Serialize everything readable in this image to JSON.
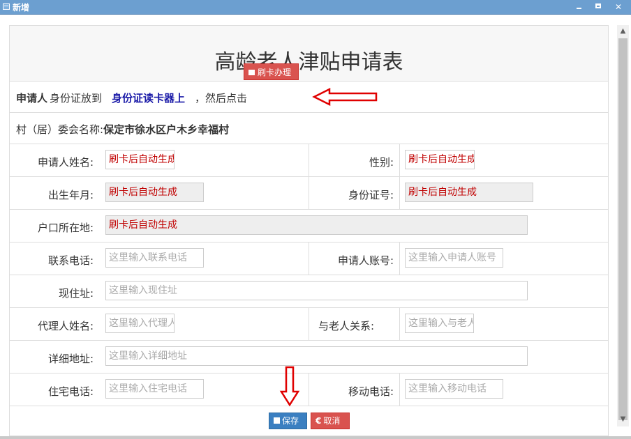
{
  "window": {
    "title": "新增"
  },
  "form": {
    "title": "高龄老人津贴申请表",
    "instruction": {
      "part1_bold": "申请人",
      "part2": "身份证放到",
      "part3_blue": "身份证读卡器上",
      "part4": "，然后点击",
      "swipe_button": "刷卡办理"
    },
    "village": {
      "label": "村（居）委会名称:",
      "value": "保定市徐水区户木乡幸福村"
    },
    "fields": {
      "applicant_name": {
        "label": "申请人姓名:",
        "value": "刷卡后自动生成"
      },
      "gender": {
        "label": "性别:",
        "value": "刷卡后自动生成"
      },
      "birth_date": {
        "label": "出生年月:",
        "value": "刷卡后自动生成"
      },
      "id_number": {
        "label": "身份证号:",
        "value": "刷卡后自动生成"
      },
      "household": {
        "label": "户口所在地:",
        "value": "刷卡后自动生成"
      },
      "phone": {
        "label": "联系电话:",
        "placeholder": "这里输入联系电话"
      },
      "account": {
        "label": "申请人账号:",
        "placeholder": "这里输入申请人账号"
      },
      "address": {
        "label": "现住址:",
        "placeholder": "这里输入现住址"
      },
      "agent_name": {
        "label": "代理人姓名:",
        "placeholder": "这里输入代理人姓名"
      },
      "relation": {
        "label": "与老人关系:",
        "placeholder": "这里输入与老人关系"
      },
      "detail_address": {
        "label": "详细地址:",
        "placeholder": "这里输入详细地址"
      },
      "home_phone": {
        "label": "住宅电话:",
        "placeholder": "这里输入住宅电话"
      },
      "mobile": {
        "label": "移动电话:",
        "placeholder": "这里输入移动电话"
      }
    },
    "buttons": {
      "save": "保存",
      "cancel": "取消"
    }
  },
  "colors": {
    "titlebar": "#6c9fd0",
    "danger": "#d9534f",
    "primary": "#3a7fc1",
    "value_red": "#c00000",
    "arrow_red": "#e00000"
  }
}
